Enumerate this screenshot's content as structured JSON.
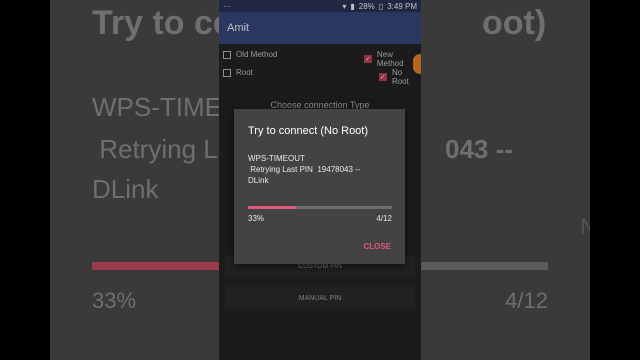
{
  "background": {
    "title": "Try to co",
    "title_tail": "oot)",
    "message_line1": "WPS-TIMEOUT",
    "message_line2": " Retrying La",
    "message_line2_tail": "043 --",
    "message_line3": "DLink",
    "progress_percent": "33%",
    "progress_count": "4/12",
    "progress_fraction": 0.33,
    "edge_left": "[",
    "edge_right": "N"
  },
  "statusbar": {
    "left": "···",
    "battery": "28%",
    "time": "3:49 PM"
  },
  "app": {
    "title": "Amit"
  },
  "options": {
    "old_method": "Old Method",
    "new_method": "New Method",
    "root": "Root",
    "no_root": "No Root"
  },
  "section": {
    "title": "Choose connection Type"
  },
  "buttons": {
    "custom_pin": "CUSTOM PIN",
    "manual_pin": "MANUAL PIN"
  },
  "dialog": {
    "title": "Try to connect (No Root)",
    "message": "WPS-TIMEOUT\n Retrying Last PIN  19478043 --\nDLink",
    "progress_percent": "33%",
    "progress_count": "4/12",
    "progress_fraction": 0.33,
    "close_label": "CLOSE"
  },
  "colors": {
    "accent": "#e2587a",
    "appbar": "#3a4a82",
    "checkbox_checked": "#c2455b"
  }
}
